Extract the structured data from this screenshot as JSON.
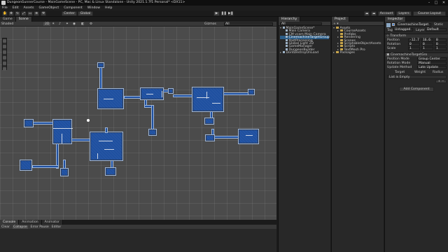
{
  "window": {
    "title": "DungeonGunnerCourse - MainGameScene - PC, Mac & Linux Standalone - Unity 2021.1.7f1 Personal* <DX11>"
  },
  "menu": [
    "File",
    "Edit",
    "Assets",
    "GameObject",
    "Component",
    "Window",
    "Help"
  ],
  "toolbar": {
    "center": "Center",
    "global": "Global",
    "account": "Account",
    "layers": "Layers",
    "layout": "Course Layout"
  },
  "scene_panel": {
    "tabs": [
      "Game",
      "Scene"
    ],
    "shading": "Shaded",
    "mode_2d": "2D",
    "gizmos": "Gizmos",
    "search_placeholder": "All"
  },
  "bottom_panel": {
    "tabs": [
      "Console",
      "Animation",
      "Animator"
    ],
    "buttons": [
      "Clear",
      "Collapse",
      "Error Pause",
      "Editor"
    ]
  },
  "hierarchy": {
    "title": "Hierarchy",
    "search": "All",
    "scene": "MainGameScene*",
    "items": [
      "Main Camera",
      "CM vcam Main Camera",
      "CinemachineTargetGroup",
      "PostProcessing",
      "Global Light 2D",
      "GameManager",
      "DungeonBuilder"
    ],
    "dontdestroy": "DontDestroyOnLoad"
  },
  "project": {
    "title": "Project",
    "root": "Assets",
    "folders": [
      "CourseAssets",
      "Prefabs",
      "Rendering",
      "Scenes",
      "ScriptableObjectAssets",
      "Scripts",
      "TextMesh Pro"
    ],
    "packages": "Packages"
  },
  "inspector": {
    "title": "Inspector",
    "object_name": "CinemachineTarget",
    "static": "Static",
    "tag_label": "Tag",
    "tag_value": "Untagged",
    "layer_label": "Layer",
    "layer_value": "Default",
    "transform": {
      "title": "Transform",
      "position": {
        "label": "Position",
        "x": "-12.7",
        "y": "16.6",
        "z": "0"
      },
      "rotation": {
        "label": "Rotation",
        "x": "0",
        "y": "0",
        "z": "0"
      },
      "scale": {
        "label": "Scale",
        "x": "1",
        "y": "1",
        "z": "1"
      }
    },
    "target_group": {
      "title": "CinemachineTargetGro",
      "position_mode_label": "Position Mode",
      "position_mode": "Group Center",
      "rotation_mode_label": "Rotation Mode",
      "rotation_mode": "Manual",
      "update_method_label": "Update Method",
      "update_method": "Late Update",
      "targets_cols": [
        "Target",
        "Weight",
        "Radius"
      ],
      "list_empty": "List is Empty"
    },
    "add_component": "Add Component"
  },
  "colors": {
    "room_fill": "#1f50a0",
    "room_border": "#9eb6d8",
    "selection": "#2c5d87",
    "viewport": "#4b4b4b"
  }
}
